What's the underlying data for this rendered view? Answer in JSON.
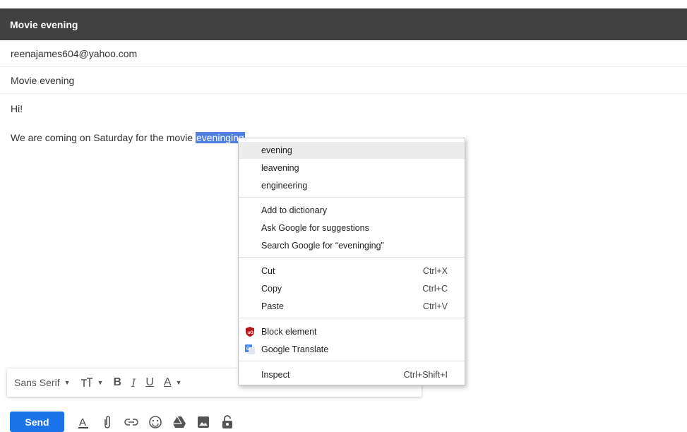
{
  "compose": {
    "title": "Movie evening",
    "to": "reenajames604@yahoo.com",
    "subject": "Movie evening",
    "greeting": "Hi!",
    "line_prefix": "We are coming on Saturday for the movie ",
    "selected_word": "eveninging"
  },
  "context_menu": {
    "suggestions": [
      "evening",
      "leavening",
      "engineering"
    ],
    "dictionary": [
      "Add to dictionary",
      "Ask Google for suggestions",
      "Search Google for “eveninging”"
    ],
    "edit": [
      {
        "label": "Cut",
        "shortcut": "Ctrl+X"
      },
      {
        "label": "Copy",
        "shortcut": "Ctrl+C"
      },
      {
        "label": "Paste",
        "shortcut": "Ctrl+V"
      }
    ],
    "extensions": [
      {
        "label": "Block element",
        "icon": "ublock-shield-icon"
      },
      {
        "label": "Google Translate",
        "icon": "google-translate-icon"
      }
    ],
    "inspect": {
      "label": "Inspect",
      "shortcut": "Ctrl+Shift+I"
    }
  },
  "format_bar": {
    "font": "Sans Serif",
    "bold": "B",
    "italic": "I",
    "underline": "U",
    "text_color": "A"
  },
  "send": {
    "label": "Send"
  },
  "colors": {
    "title_bg": "#404040",
    "send_bg": "#1a73e8",
    "selection": "#4f7fe0"
  }
}
